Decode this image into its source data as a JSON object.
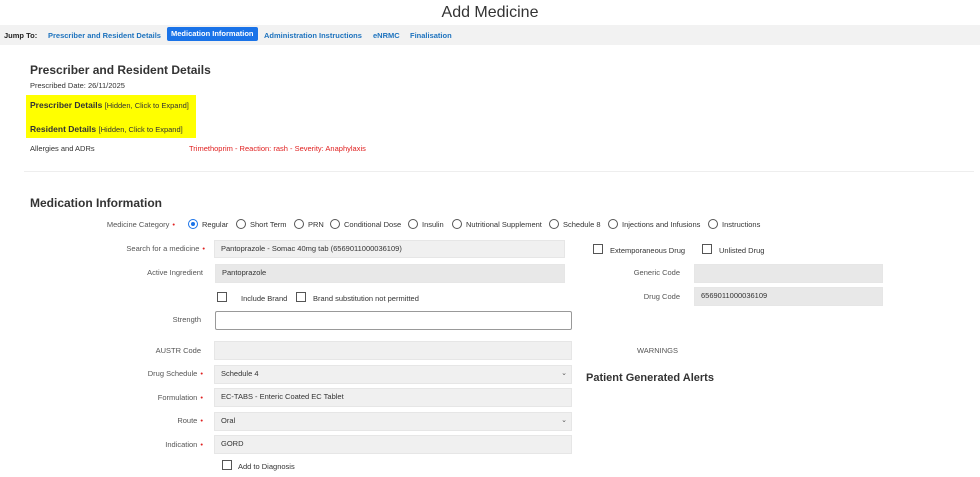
{
  "title": "Add Medicine",
  "jump": {
    "label": "Jump To:",
    "links": [
      "Prescriber and Resident Details",
      "Medication Information",
      "Administration Instructions",
      "eNRMC",
      "Finalisation"
    ]
  },
  "prescriber_section": {
    "title": "Prescriber and Resident Details",
    "prescribed_date": "Prescribed Date: 26/11/2025",
    "prescriber_details": "Prescriber Details",
    "resident_details": "Resident Details",
    "hidden_hint": "[Hidden, Click to Expand]",
    "allergies_label": "Allergies and ADRs",
    "allergies_value": "Trimethoprim - Reaction: rash - Severity: Anaphylaxis"
  },
  "medication": {
    "title": "Medication Information",
    "category_label": "Medicine Category",
    "categories": [
      "Regular",
      "Short Term",
      "PRN",
      "Conditional Dose",
      "Insulin",
      "Nutritional Supplement",
      "Schedule 8",
      "Injections and Infusions",
      "Instructions"
    ],
    "selected_category": "Regular",
    "search_label": "Search for a medicine",
    "search_value": "Pantoprazole - Somac 40mg tab (6569011000036109)",
    "extemporaneous": "Extemporaneous Drug",
    "unlisted": "Unlisted Drug",
    "active_ingredient_label": "Active Ingredient",
    "active_ingredient_value": "Pantoprazole",
    "generic_code_label": "Generic Code",
    "generic_code_value": "",
    "include_brand": "Include Brand",
    "brand_substitution": "Brand substitution not permitted",
    "drug_code_label": "Drug Code",
    "drug_code_value": "6569011000036109",
    "strength_label": "Strength",
    "strength_value": "",
    "austr_label": "AUSTR Code",
    "austr_value": "",
    "warnings_label": "WARNINGS",
    "schedule_label": "Drug Schedule",
    "schedule_value": "Schedule 4",
    "formulation_label": "Formulation",
    "formulation_value": "EC-TABS - Enteric Coated EC Tablet",
    "route_label": "Route",
    "route_value": "Oral",
    "indication_label": "Indication",
    "indication_value": "GORD",
    "add_diagnosis": "Add to Diagnosis",
    "patient_alerts": "Patient Generated Alerts",
    "required_mark": "•",
    "caret": "⌄"
  }
}
